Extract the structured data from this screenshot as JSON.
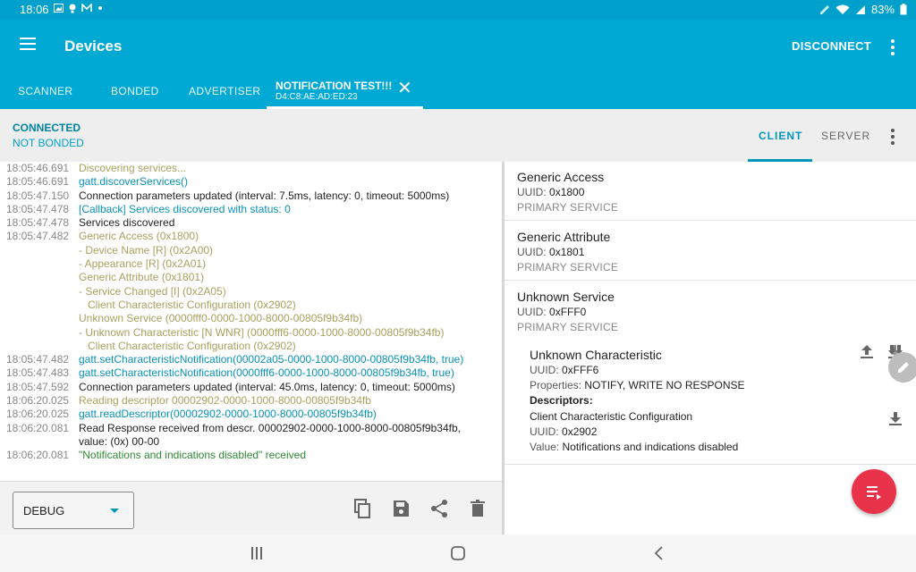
{
  "status_bar": {
    "time": "18:06",
    "battery": "83%"
  },
  "app_bar": {
    "title": "Devices",
    "disconnect_label": "DISCONNECT"
  },
  "tabs": {
    "items": [
      "SCANNER",
      "BONDED",
      "ADVERTISER"
    ],
    "active_title": "NOTIFICATION TEST!!!",
    "active_address": "D4:C8:AE:AD:ED:23"
  },
  "connection": {
    "state": "CONNECTED",
    "bond": "NOT BONDED",
    "client_tab": "CLIENT",
    "server_tab": "SERVER"
  },
  "log": {
    "rows": [
      {
        "ts": "18:05:46.691",
        "msg": "Discovering services...",
        "color": "olive"
      },
      {
        "ts": "18:05:46.691",
        "msg": "gatt.discoverServices()",
        "color": "blue"
      },
      {
        "ts": "18:05:47.150",
        "msg": "Connection parameters updated (interval: 7.5ms, latency: 0, timeout: 5000ms)",
        "color": "black"
      },
      {
        "ts": "18:05:47.478",
        "msg": "[Callback] Services discovered with status: 0",
        "color": "blue"
      },
      {
        "ts": "18:05:47.478",
        "msg": "Services discovered",
        "color": "black"
      },
      {
        "ts": "18:05:47.482",
        "msg": "Generic Access (0x1800)",
        "color": "olive"
      },
      {
        "ts": "",
        "msg": "- Device Name [R] (0x2A00)",
        "color": "olive"
      },
      {
        "ts": "",
        "msg": "- Appearance [R] (0x2A01)",
        "color": "olive"
      },
      {
        "ts": "",
        "msg": "Generic Attribute (0x1801)",
        "color": "olive"
      },
      {
        "ts": "",
        "msg": "- Service Changed [I] (0x2A05)",
        "color": "olive"
      },
      {
        "ts": "",
        "msg": "   Client Characteristic Configuration (0x2902)",
        "color": "olive"
      },
      {
        "ts": "",
        "msg": "Unknown Service (0000fff0-0000-1000-8000-00805f9b34fb)",
        "color": "olive"
      },
      {
        "ts": "",
        "msg": "- Unknown Characteristic [N WNR] (0000fff6-0000-1000-8000-00805f9b34fb)",
        "color": "olive"
      },
      {
        "ts": "",
        "msg": "   Client Characteristic Configuration (0x2902)",
        "color": "olive"
      },
      {
        "ts": "18:05:47.482",
        "msg": "gatt.setCharacteristicNotification(00002a05-0000-1000-8000-00805f9b34fb, true)",
        "color": "blue"
      },
      {
        "ts": "18:05:47.483",
        "msg": "gatt.setCharacteristicNotification(0000fff6-0000-1000-8000-00805f9b34fb, true)",
        "color": "blue"
      },
      {
        "ts": "18:05:47.592",
        "msg": "Connection parameters updated (interval: 45.0ms, latency: 0, timeout: 5000ms)",
        "color": "black"
      },
      {
        "ts": "18:06:20.025",
        "msg": "Reading descriptor 00002902-0000-1000-8000-00805f9b34fb",
        "color": "olive"
      },
      {
        "ts": "18:06:20.025",
        "msg": "gatt.readDescriptor(00002902-0000-1000-8000-00805f9b34fb)",
        "color": "blue"
      },
      {
        "ts": "18:06:20.081",
        "msg": "Read Response received from descr. 00002902-0000-1000-8000-00805f9b34fb,",
        "color": "black"
      },
      {
        "ts": "",
        "msg": "value: (0x) 00-00",
        "color": "black"
      },
      {
        "ts": "18:06:20.081",
        "msg": "\"Notifications and indications disabled\" received",
        "color": "green"
      }
    ],
    "level": "DEBUG"
  },
  "services": [
    {
      "name": "Generic Access",
      "uuid_label": "UUID:",
      "uuid": "0x1800",
      "type": "PRIMARY SERVICE"
    },
    {
      "name": "Generic Attribute",
      "uuid_label": "UUID:",
      "uuid": "0x1801",
      "type": "PRIMARY SERVICE"
    },
    {
      "name": "Unknown Service",
      "uuid_label": "UUID:",
      "uuid": "0xFFF0",
      "type": "PRIMARY SERVICE"
    }
  ],
  "characteristic": {
    "name": "Unknown Characteristic",
    "uuid_label": "UUID:",
    "uuid": "0xFFF6",
    "properties_label": "Properties:",
    "properties": "NOTIFY, WRITE NO RESPONSE",
    "descriptors_label": "Descriptors:",
    "descriptor_name": "Client Characteristic Configuration",
    "descriptor_uuid_label": "UUID:",
    "descriptor_uuid": "0x2902",
    "descriptor_value_label": "Value:",
    "descriptor_value": "Notifications and indications disabled"
  },
  "colors": {
    "primary": "#00a9d4",
    "accent": "#e8334a",
    "log_olive": "#a8a15e",
    "log_blue": "#0a92b7",
    "log_green": "#2f8a34"
  }
}
